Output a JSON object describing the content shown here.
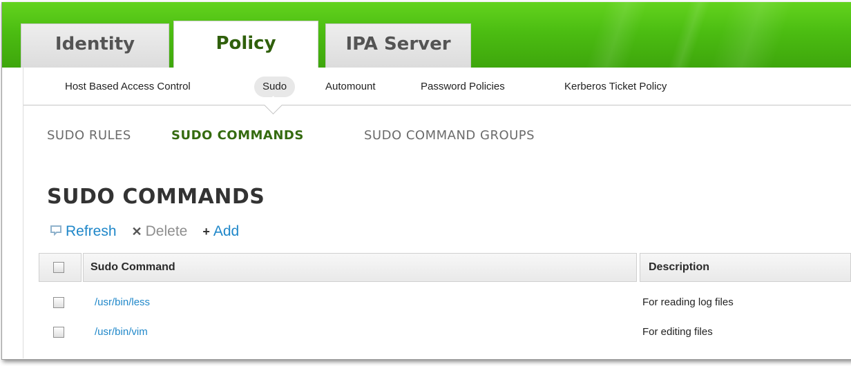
{
  "top_tabs": [
    {
      "label": "Identity",
      "active": false
    },
    {
      "label": "Policy",
      "active": true
    },
    {
      "label": "IPA Server",
      "active": false
    }
  ],
  "sub_nav": [
    {
      "label": "Host Based Access Control",
      "selected": false
    },
    {
      "label": "Sudo",
      "selected": true
    },
    {
      "label": "Automount",
      "selected": false
    },
    {
      "label": "Password Policies",
      "selected": false
    },
    {
      "label": "Kerberos Ticket Policy",
      "selected": false
    }
  ],
  "section_tabs": [
    {
      "label": "SUDO RULES",
      "active": false
    },
    {
      "label": "SUDO COMMANDS",
      "active": true
    },
    {
      "label": "SUDO COMMAND GROUPS",
      "active": false
    }
  ],
  "page_title": "SUDO COMMANDS",
  "actions": {
    "refresh": {
      "label": "Refresh",
      "icon": "refresh-icon"
    },
    "delete": {
      "label": "Delete",
      "icon": "delete-icon",
      "enabled": false
    },
    "add": {
      "label": "Add",
      "icon": "add-icon"
    }
  },
  "table": {
    "columns": [
      "Sudo Command",
      "Description"
    ],
    "rows": [
      {
        "command": "/usr/bin/less",
        "description": "For reading log files"
      },
      {
        "command": "/usr/bin/vim",
        "description": "For editing files"
      }
    ]
  },
  "colors": {
    "banner": "#4cbd12",
    "active_tab_text": "#2f5f0b",
    "link": "#1f87c9"
  }
}
